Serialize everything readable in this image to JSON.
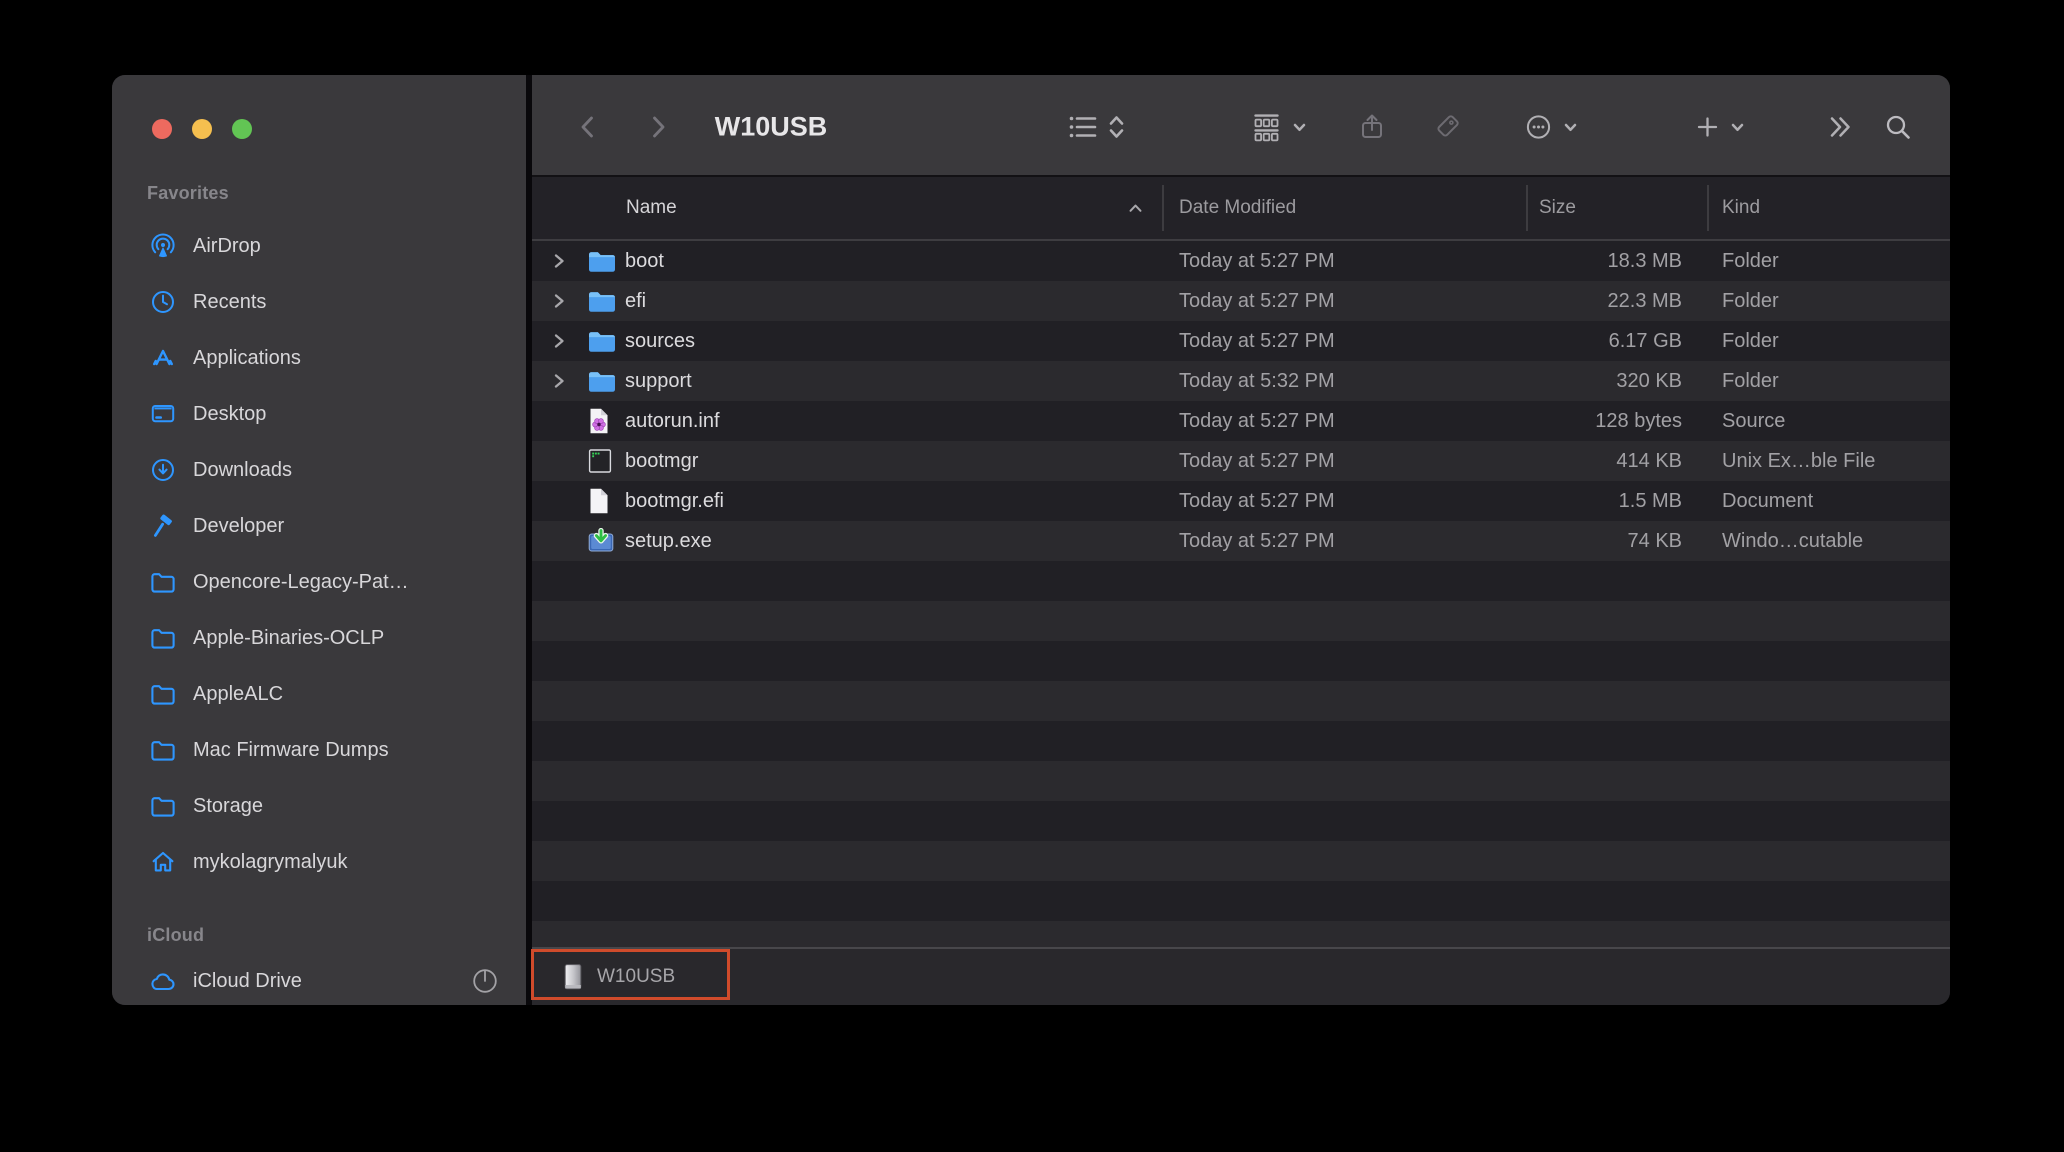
{
  "window": {
    "title": "W10USB",
    "traffic_lights": [
      {
        "name": "close",
        "color": "#ed6a5f"
      },
      {
        "name": "minimize",
        "color": "#f5bf4f"
      },
      {
        "name": "zoom",
        "color": "#62c554"
      }
    ]
  },
  "toolbar": {
    "icons": [
      "chevron-left",
      "chevron-right",
      "list-view",
      "updown-chevrons",
      "group-view",
      "chevron-down",
      "share",
      "tag",
      "more-ellipsis",
      "chevron-down",
      "plus",
      "chevron-down",
      "double-chevron",
      "search"
    ]
  },
  "sidebar": {
    "sections": [
      {
        "label": "Favorites",
        "items": [
          {
            "label": "AirDrop",
            "icon": "airdrop"
          },
          {
            "label": "Recents",
            "icon": "clock"
          },
          {
            "label": "Applications",
            "icon": "appstore"
          },
          {
            "label": "Desktop",
            "icon": "desktop"
          },
          {
            "label": "Downloads",
            "icon": "download-circle"
          },
          {
            "label": "Developer",
            "icon": "hammer"
          },
          {
            "label": "Opencore-Legacy-Pat…",
            "icon": "folder"
          },
          {
            "label": "Apple-Binaries-OCLP",
            "icon": "folder"
          },
          {
            "label": "AppleALC",
            "icon": "folder"
          },
          {
            "label": "Mac Firmware Dumps",
            "icon": "folder"
          },
          {
            "label": "Storage",
            "icon": "folder"
          },
          {
            "label": "mykolagrymalyuk",
            "icon": "home"
          }
        ]
      },
      {
        "label": "iCloud",
        "items": [
          {
            "label": "iCloud Drive",
            "icon": "cloud",
            "trailing_icon": "progress-pie"
          }
        ]
      }
    ]
  },
  "list": {
    "columns": [
      {
        "label": "Name",
        "sorted": "asc"
      },
      {
        "label": "Date Modified"
      },
      {
        "label": "Size"
      },
      {
        "label": "Kind"
      }
    ],
    "rows": [
      {
        "name": "boot",
        "icon": "folder-blue",
        "expandable": true,
        "date_modified": "Today at 5:27 PM",
        "size": "18.3 MB",
        "kind": "Folder"
      },
      {
        "name": "efi",
        "icon": "folder-blue",
        "expandable": true,
        "date_modified": "Today at 5:27 PM",
        "size": "22.3 MB",
        "kind": "Folder"
      },
      {
        "name": "sources",
        "icon": "folder-blue",
        "expandable": true,
        "date_modified": "Today at 5:27 PM",
        "size": "6.17 GB",
        "kind": "Folder"
      },
      {
        "name": "support",
        "icon": "folder-blue",
        "expandable": true,
        "date_modified": "Today at 5:32 PM",
        "size": "320 KB",
        "kind": "Folder"
      },
      {
        "name": "autorun.inf",
        "icon": "inf-document",
        "expandable": false,
        "date_modified": "Today at 5:27 PM",
        "size": "128 bytes",
        "kind": "Source"
      },
      {
        "name": "bootmgr",
        "icon": "unix-executable",
        "expandable": false,
        "date_modified": "Today at 5:27 PM",
        "size": "414 KB",
        "kind": "Unix Ex…ble File"
      },
      {
        "name": "bootmgr.efi",
        "icon": "document",
        "expandable": false,
        "date_modified": "Today at 5:27 PM",
        "size": "1.5 MB",
        "kind": "Document"
      },
      {
        "name": "setup.exe",
        "icon": "windows-executable",
        "expandable": false,
        "date_modified": "Today at 5:27 PM",
        "size": "74 KB",
        "kind": "Windo…cutable"
      }
    ]
  },
  "pathbar": {
    "items": [
      {
        "label": "W10USB",
        "icon": "disk"
      }
    ],
    "annotation_color": "#d04b2b"
  },
  "colors": {
    "accent_blue": "#2e96ff",
    "sidebar_bg": "#3a393c",
    "row_dark": "#212025",
    "row_light": "#2b2a2e"
  }
}
